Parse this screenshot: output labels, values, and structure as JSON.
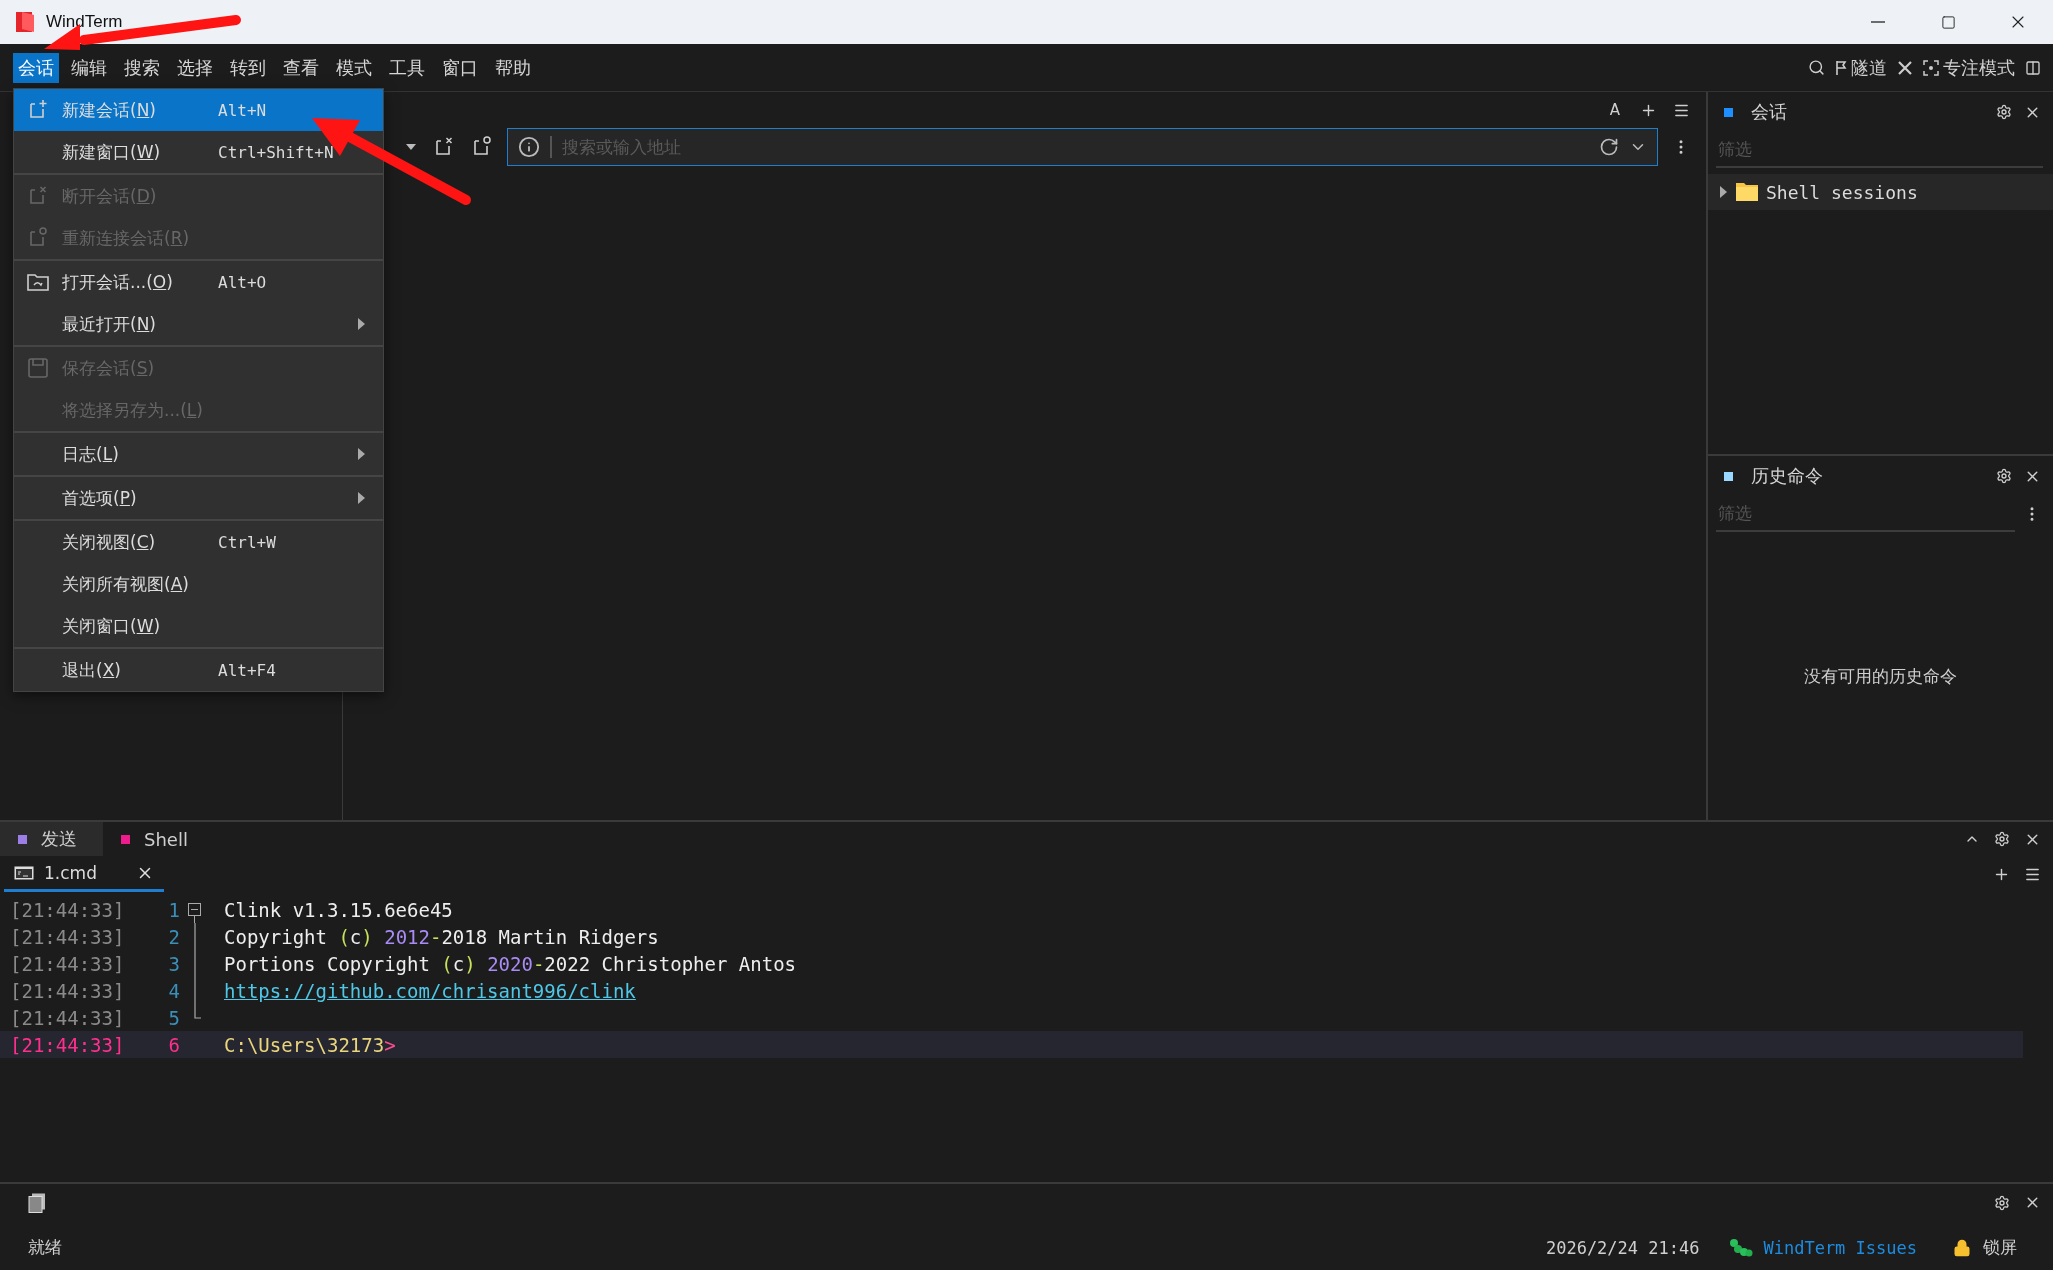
{
  "window": {
    "title": "WindTerm"
  },
  "menubar": {
    "items": [
      {
        "label": "会话",
        "selected": true
      },
      {
        "label": "编辑",
        "selected": false
      },
      {
        "label": "搜索",
        "selected": false
      },
      {
        "label": "选择",
        "selected": false
      },
      {
        "label": "转到",
        "selected": false
      },
      {
        "label": "查看",
        "selected": false
      },
      {
        "label": "模式",
        "selected": false
      },
      {
        "label": "工具",
        "selected": false
      },
      {
        "label": "窗口",
        "selected": false
      },
      {
        "label": "帮助",
        "selected": false
      }
    ],
    "tools": [
      {
        "label": "隧道"
      },
      {
        "label": "专注模式"
      }
    ]
  },
  "session_menu": {
    "groups": [
      [
        {
          "prefix": "新建会话(",
          "mnemonic": "N",
          "suffix": ")",
          "shortcut": "Alt+N",
          "selected": true,
          "disabled": false
        },
        {
          "prefix": "新建窗口(",
          "mnemonic": "W",
          "suffix": ")",
          "shortcut": "Ctrl+Shift+N",
          "selected": false,
          "disabled": false
        }
      ],
      [
        {
          "prefix": "断开会话(",
          "mnemonic": "D",
          "suffix": ")",
          "selected": false,
          "disabled": true
        },
        {
          "prefix": "重新连接会话(",
          "mnemonic": "R",
          "suffix": ")",
          "selected": false,
          "disabled": true
        }
      ],
      [
        {
          "prefix": "打开会话...(",
          "mnemonic": "O",
          "suffix": ")",
          "shortcut": "Alt+O",
          "selected": false,
          "disabled": false
        },
        {
          "prefix": "最近打开(",
          "mnemonic": "N",
          "suffix": ")",
          "submenu": true,
          "selected": false,
          "disabled": false
        }
      ],
      [
        {
          "prefix": "保存会话(",
          "mnemonic": "S",
          "suffix": ")",
          "selected": false,
          "disabled": true
        },
        {
          "prefix": "将选择另存为...(",
          "mnemonic": "L",
          "suffix": ")",
          "selected": false,
          "disabled": true
        }
      ],
      [
        {
          "prefix": "日志(",
          "mnemonic": "L",
          "suffix": ")",
          "submenu": true,
          "selected": false,
          "disabled": false
        }
      ],
      [
        {
          "prefix": "首选项(",
          "mnemonic": "P",
          "suffix": ")",
          "submenu": true,
          "selected": false,
          "disabled": false
        }
      ],
      [
        {
          "prefix": "关闭视图(",
          "mnemonic": "C",
          "suffix": ")",
          "shortcut": "Ctrl+W",
          "selected": false,
          "disabled": false
        },
        {
          "prefix": "关闭所有视图(",
          "mnemonic": "A",
          "suffix": ")",
          "selected": false,
          "disabled": false
        },
        {
          "prefix": "关闭窗口(",
          "mnemonic": "W",
          "suffix": ")",
          "selected": false,
          "disabled": false
        }
      ],
      [
        {
          "prefix": "退出(",
          "mnemonic": "X",
          "suffix": ")",
          "shortcut": "Alt+F4",
          "selected": false,
          "disabled": false
        }
      ]
    ]
  },
  "center": {
    "font_button": "A",
    "address_bar": {
      "placeholder": "搜索或输入地址"
    }
  },
  "sessions_panel": {
    "title": "会话",
    "color": "#1e8fff",
    "filter": {
      "placeholder": "筛选"
    },
    "tree": [
      {
        "label": "Shell sessions",
        "expanded": false
      }
    ]
  },
  "history_panel": {
    "title": "历史命令",
    "color": "#9ad8ff",
    "filter": {
      "placeholder": "筛选"
    },
    "empty_message": "没有可用的历史命令"
  },
  "bottom_tabs": [
    {
      "label": "发送",
      "color": "#9b7fe6",
      "selected": true
    },
    {
      "label": "Shell",
      "color": "#ee1c8c",
      "selected": false
    }
  ],
  "terminal": {
    "tabs": [
      {
        "label": "1.cmd",
        "selected": true
      }
    ],
    "lines": [
      {
        "time": "[21:44:33]",
        "number": "1",
        "current": false,
        "fold_start": true,
        "in_fold": false,
        "fold_end": false,
        "segments": [
          {
            "text": "Clink v1.3.15.6e6e45",
            "color": "#eeeeee"
          }
        ]
      },
      {
        "time": "[21:44:33]",
        "number": "2",
        "current": false,
        "fold_start": false,
        "in_fold": true,
        "fold_end": false,
        "segments": [
          {
            "text": "Copyright ",
            "color": "#eeeeee"
          },
          {
            "text": "(",
            "color": "#c6e15b"
          },
          {
            "text": "c",
            "color": "#eeeeee"
          },
          {
            "text": ") ",
            "color": "#c6e15b"
          },
          {
            "text": "2012",
            "color": "#a98bf5"
          },
          {
            "text": "-",
            "color": "#c6e15b"
          },
          {
            "text": "2018 Martin Ridgers",
            "color": "#eeeeee"
          }
        ]
      },
      {
        "time": "[21:44:33]",
        "number": "3",
        "current": false,
        "fold_start": false,
        "in_fold": true,
        "fold_end": false,
        "segments": [
          {
            "text": "Portions Copyright ",
            "color": "#eeeeee"
          },
          {
            "text": "(",
            "color": "#c6e15b"
          },
          {
            "text": "c",
            "color": "#eeeeee"
          },
          {
            "text": ") ",
            "color": "#c6e15b"
          },
          {
            "text": "2020",
            "color": "#a98bf5"
          },
          {
            "text": "-",
            "color": "#c6e15b"
          },
          {
            "text": "2022 Christopher Antos",
            "color": "#eeeeee"
          }
        ]
      },
      {
        "time": "[21:44:33]",
        "number": "4",
        "current": false,
        "fold_start": false,
        "in_fold": true,
        "fold_end": false,
        "segments": [
          {
            "text": "https://github.com/chrisant996/clink",
            "color": "#4fc8e8",
            "link": true
          }
        ]
      },
      {
        "time": "[21:44:33]",
        "number": "5",
        "current": false,
        "fold_start": false,
        "in_fold": false,
        "fold_end": true
      },
      {
        "time": "[21:44:33]",
        "number": "6",
        "current": true,
        "fold_start": false,
        "in_fold": false,
        "fold_end": false,
        "segments": [
          {
            "text": "C:\\Users\\32173",
            "color": "#e8d57c"
          },
          {
            "text": ">",
            "color": "#ff4d8f"
          }
        ]
      }
    ]
  },
  "status_bar": {
    "text": "就绪",
    "datetime": "2026/2/24 21:46",
    "issues_link": "WindTerm Issues",
    "lock": "锁屏"
  }
}
